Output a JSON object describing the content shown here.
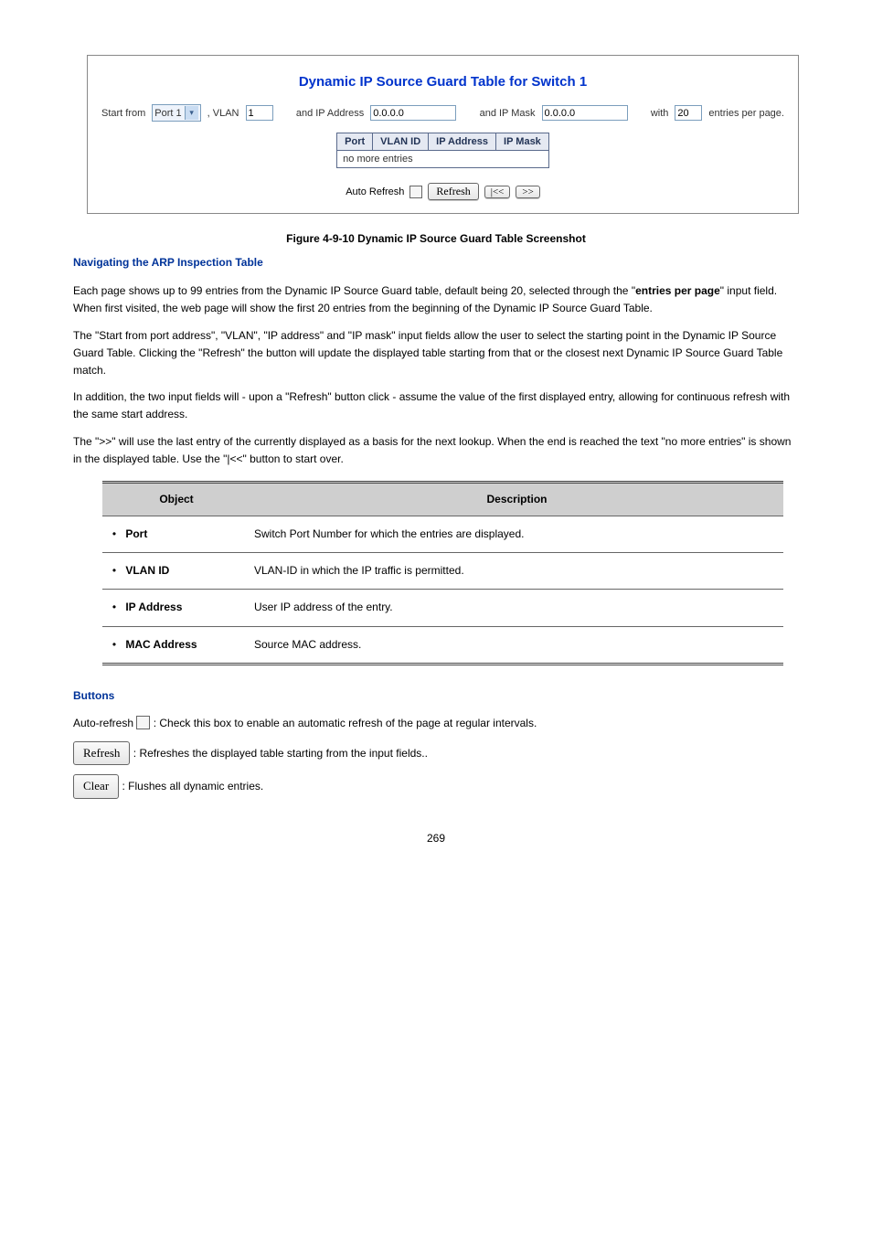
{
  "figure": {
    "title": "Dynamic IP Source Guard Table for Switch 1",
    "start_from_label": "Start from",
    "port_value": "Port 1",
    "vlan_label": ", VLAN",
    "vlan_value": "1",
    "ip_addr_label": "and IP Address",
    "ip_addr_value": "0.0.0.0",
    "ip_mask_label": "and IP Mask",
    "ip_mask_value": "0.0.0.0",
    "with_label": "with",
    "entries_value": "20",
    "entries_suffix": "entries per page.",
    "th_port": "Port",
    "th_vlan": "VLAN ID",
    "th_ip": "IP Address",
    "th_mask": "IP Mask",
    "no_entries": "no more entries",
    "auto_refresh_label": "Auto Refresh",
    "refresh_label": "Refresh",
    "prev_label": "|<<",
    "next_label": ">>"
  },
  "caption": "Figure 4-9-10 Dynamic IP Source Guard Table Screenshot",
  "nav": {
    "heading": "Navigating the ARP Inspection Table",
    "para1a": "Each page shows up to 99 entries from the Dynamic IP Source Guard table, default being 20, selected through the \"",
    "entries_bold": "entries per page",
    "para1b": "\" input field. When first visited, the web page will show the first 20 entries from the beginning of the Dynamic IP Source Guard Table.",
    "para_first": "The \"Start from port address\", \"VLAN\", \"IP address\" and \"IP mask\" input fields allow the user to select the starting point in the Dynamic IP Source Guard Table. Clicking the \"Refresh\" the button will update the displayed table starting from that or the closest next Dynamic IP Source Guard Table match.",
    "para_second": "In addition, the two input fields will - upon a \"Refresh\" button click - assume the value of the first displayed entry, allowing for continuous refresh with the same start address.",
    "para_third": "The \">>\" will use the last entry of the currently displayed as a basis for the next lookup. When the end is reached the text \"no more entries\" is shown in the displayed table. Use the \"|<<\" button to start over."
  },
  "table": {
    "h_obj": "Object",
    "h_desc": "Description",
    "rows": [
      {
        "obj": "Port",
        "desc": "Switch Port Number for which the entries are displayed."
      },
      {
        "obj": "VLAN ID",
        "desc": "VLAN-ID in which the IP traffic is permitted."
      },
      {
        "obj": "IP Address",
        "desc": "User IP address of the entry."
      },
      {
        "obj": "MAC Address",
        "desc": "Source MAC address."
      }
    ]
  },
  "buttons": {
    "heading": "Buttons",
    "auto_refresh": "Auto-refresh : Check this box to enable an automatic refresh of the page at regular intervals.",
    "refresh_desc": ": Refreshes the displayed table starting from the input fields..",
    "clear_desc": ": Flushes all dynamic entries.",
    "refresh_label": "Refresh",
    "clear_label": "Clear"
  },
  "pagenum": "269"
}
